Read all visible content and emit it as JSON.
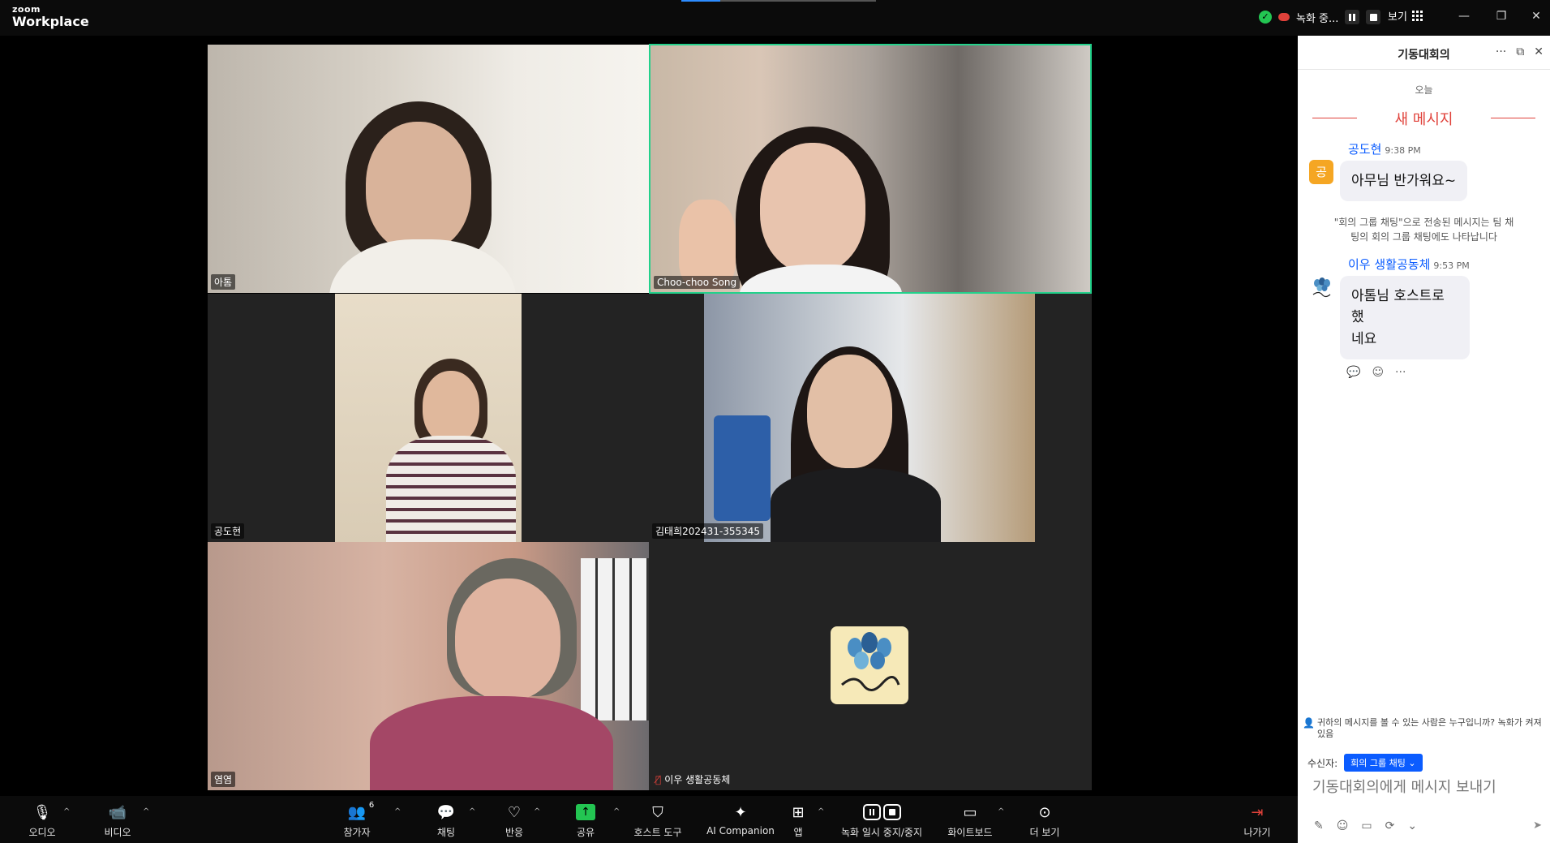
{
  "app": {
    "logo_small": "zoom",
    "logo_big": "Workplace"
  },
  "titlebar": {
    "recording_label": "녹화 중...",
    "view_label": "보기",
    "progress_fraction": 0.2
  },
  "participants": [
    {
      "name": "아톰",
      "muted": false
    },
    {
      "name": "Choo-choo Song",
      "muted": false,
      "active_speaker": true
    },
    {
      "name": "공도현",
      "muted": false
    },
    {
      "name": "김태희202431-355345",
      "muted": false
    },
    {
      "name": "염염",
      "muted": false
    },
    {
      "name": "이우 생활공동체",
      "muted": true,
      "video_off": true
    }
  ],
  "chat": {
    "title": "기동대회의",
    "date_separator": "오늘",
    "new_messages_label": "새 메시지",
    "messages": [
      {
        "sender": "공도현",
        "avatar_letter": "공",
        "time": "9:38 PM",
        "text": "아무님 반가워요~"
      },
      {
        "sender": "이우 생활공동체",
        "time": "9:53 PM",
        "text_line1": "아톰님 호스트로 했",
        "text_line2": "네요"
      }
    ],
    "system_note": "\"회의 그룹 채팅\"으로 전송된 메시지는 팀 채팅의 회의 그룹 채팅에도 나타납니다",
    "privacy_note": "귀하의 메시지를 볼 수 있는 사람은 누구입니까? 녹화가 켜져 있음",
    "recipient_label": "수신자:",
    "recipient_value": "회의 그룹 채팅",
    "input_placeholder": "기동대회의에게 메시지 보내기"
  },
  "toolbar": {
    "audio": "오디오",
    "video": "비디오",
    "participants": "참가자",
    "participants_count": "6",
    "chat": "채팅",
    "reactions": "반응",
    "share": "공유",
    "host_tools": "호스트 도구",
    "ai_companion": "AI Companion",
    "apps": "앱",
    "recording": "녹화 일시 중지/중지",
    "whiteboard": "화이트보드",
    "more": "더 보기",
    "leave": "나가기"
  }
}
